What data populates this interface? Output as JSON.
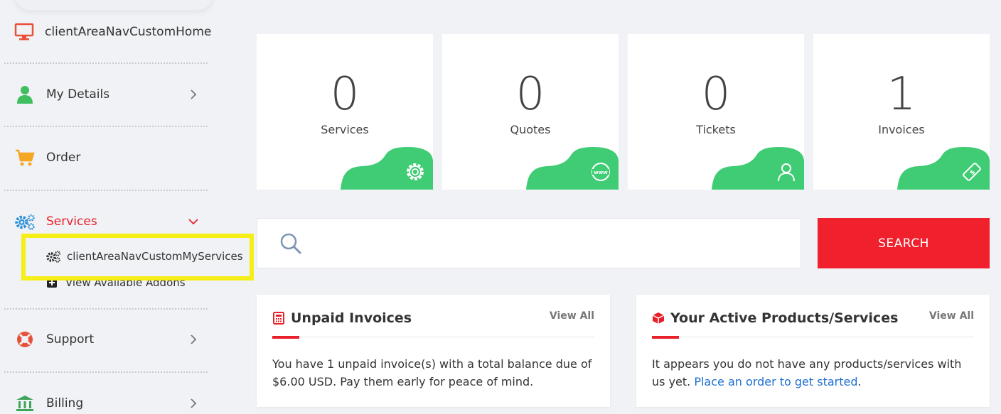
{
  "sidebar": {
    "items": [
      {
        "label": "clientAreaNavCustomHome",
        "icon": "monitor-icon"
      },
      {
        "label": "My Details",
        "icon": "user-icon"
      },
      {
        "label": "Order",
        "icon": "cart-icon"
      },
      {
        "label": "Services",
        "icon": "gears-icon",
        "expanded": true,
        "active_color": "#e8202a"
      },
      {
        "label": "Support",
        "icon": "lifebuoy-icon"
      },
      {
        "label": "Billing",
        "icon": "bank-icon"
      }
    ],
    "services_sub": [
      {
        "label": "clientAreaNavCustomMyServices",
        "icon": "gears-icon"
      },
      {
        "label": "View Available Addons",
        "icon": "plus-square-icon"
      }
    ]
  },
  "stats": [
    {
      "value": "0",
      "label": "Services",
      "icon": "gear-icon"
    },
    {
      "value": "0",
      "label": "Quotes",
      "icon": "www-globe-icon"
    },
    {
      "value": "0",
      "label": "Tickets",
      "icon": "user-icon"
    },
    {
      "value": "1",
      "label": "Invoices",
      "icon": "ticket-icon"
    }
  ],
  "search": {
    "placeholder": "",
    "button_label": "SEARCH"
  },
  "panels": {
    "unpaid": {
      "title": "Unpaid Invoices",
      "view_all": "View All",
      "text": "You have 1 unpaid invoice(s) with a total balance due of $6.00 USD. Pay them early for peace of mind."
    },
    "active": {
      "title": "Your Active Products/Services",
      "view_all": "View All",
      "text": "It appears you do not have any products/services with us yet.",
      "link": "Place an order to get started",
      "suffix": "."
    }
  },
  "colors": {
    "accent_red": "#e8202a",
    "blob_green": "#3fcc74",
    "highlight_yellow": "#f5ee17"
  }
}
